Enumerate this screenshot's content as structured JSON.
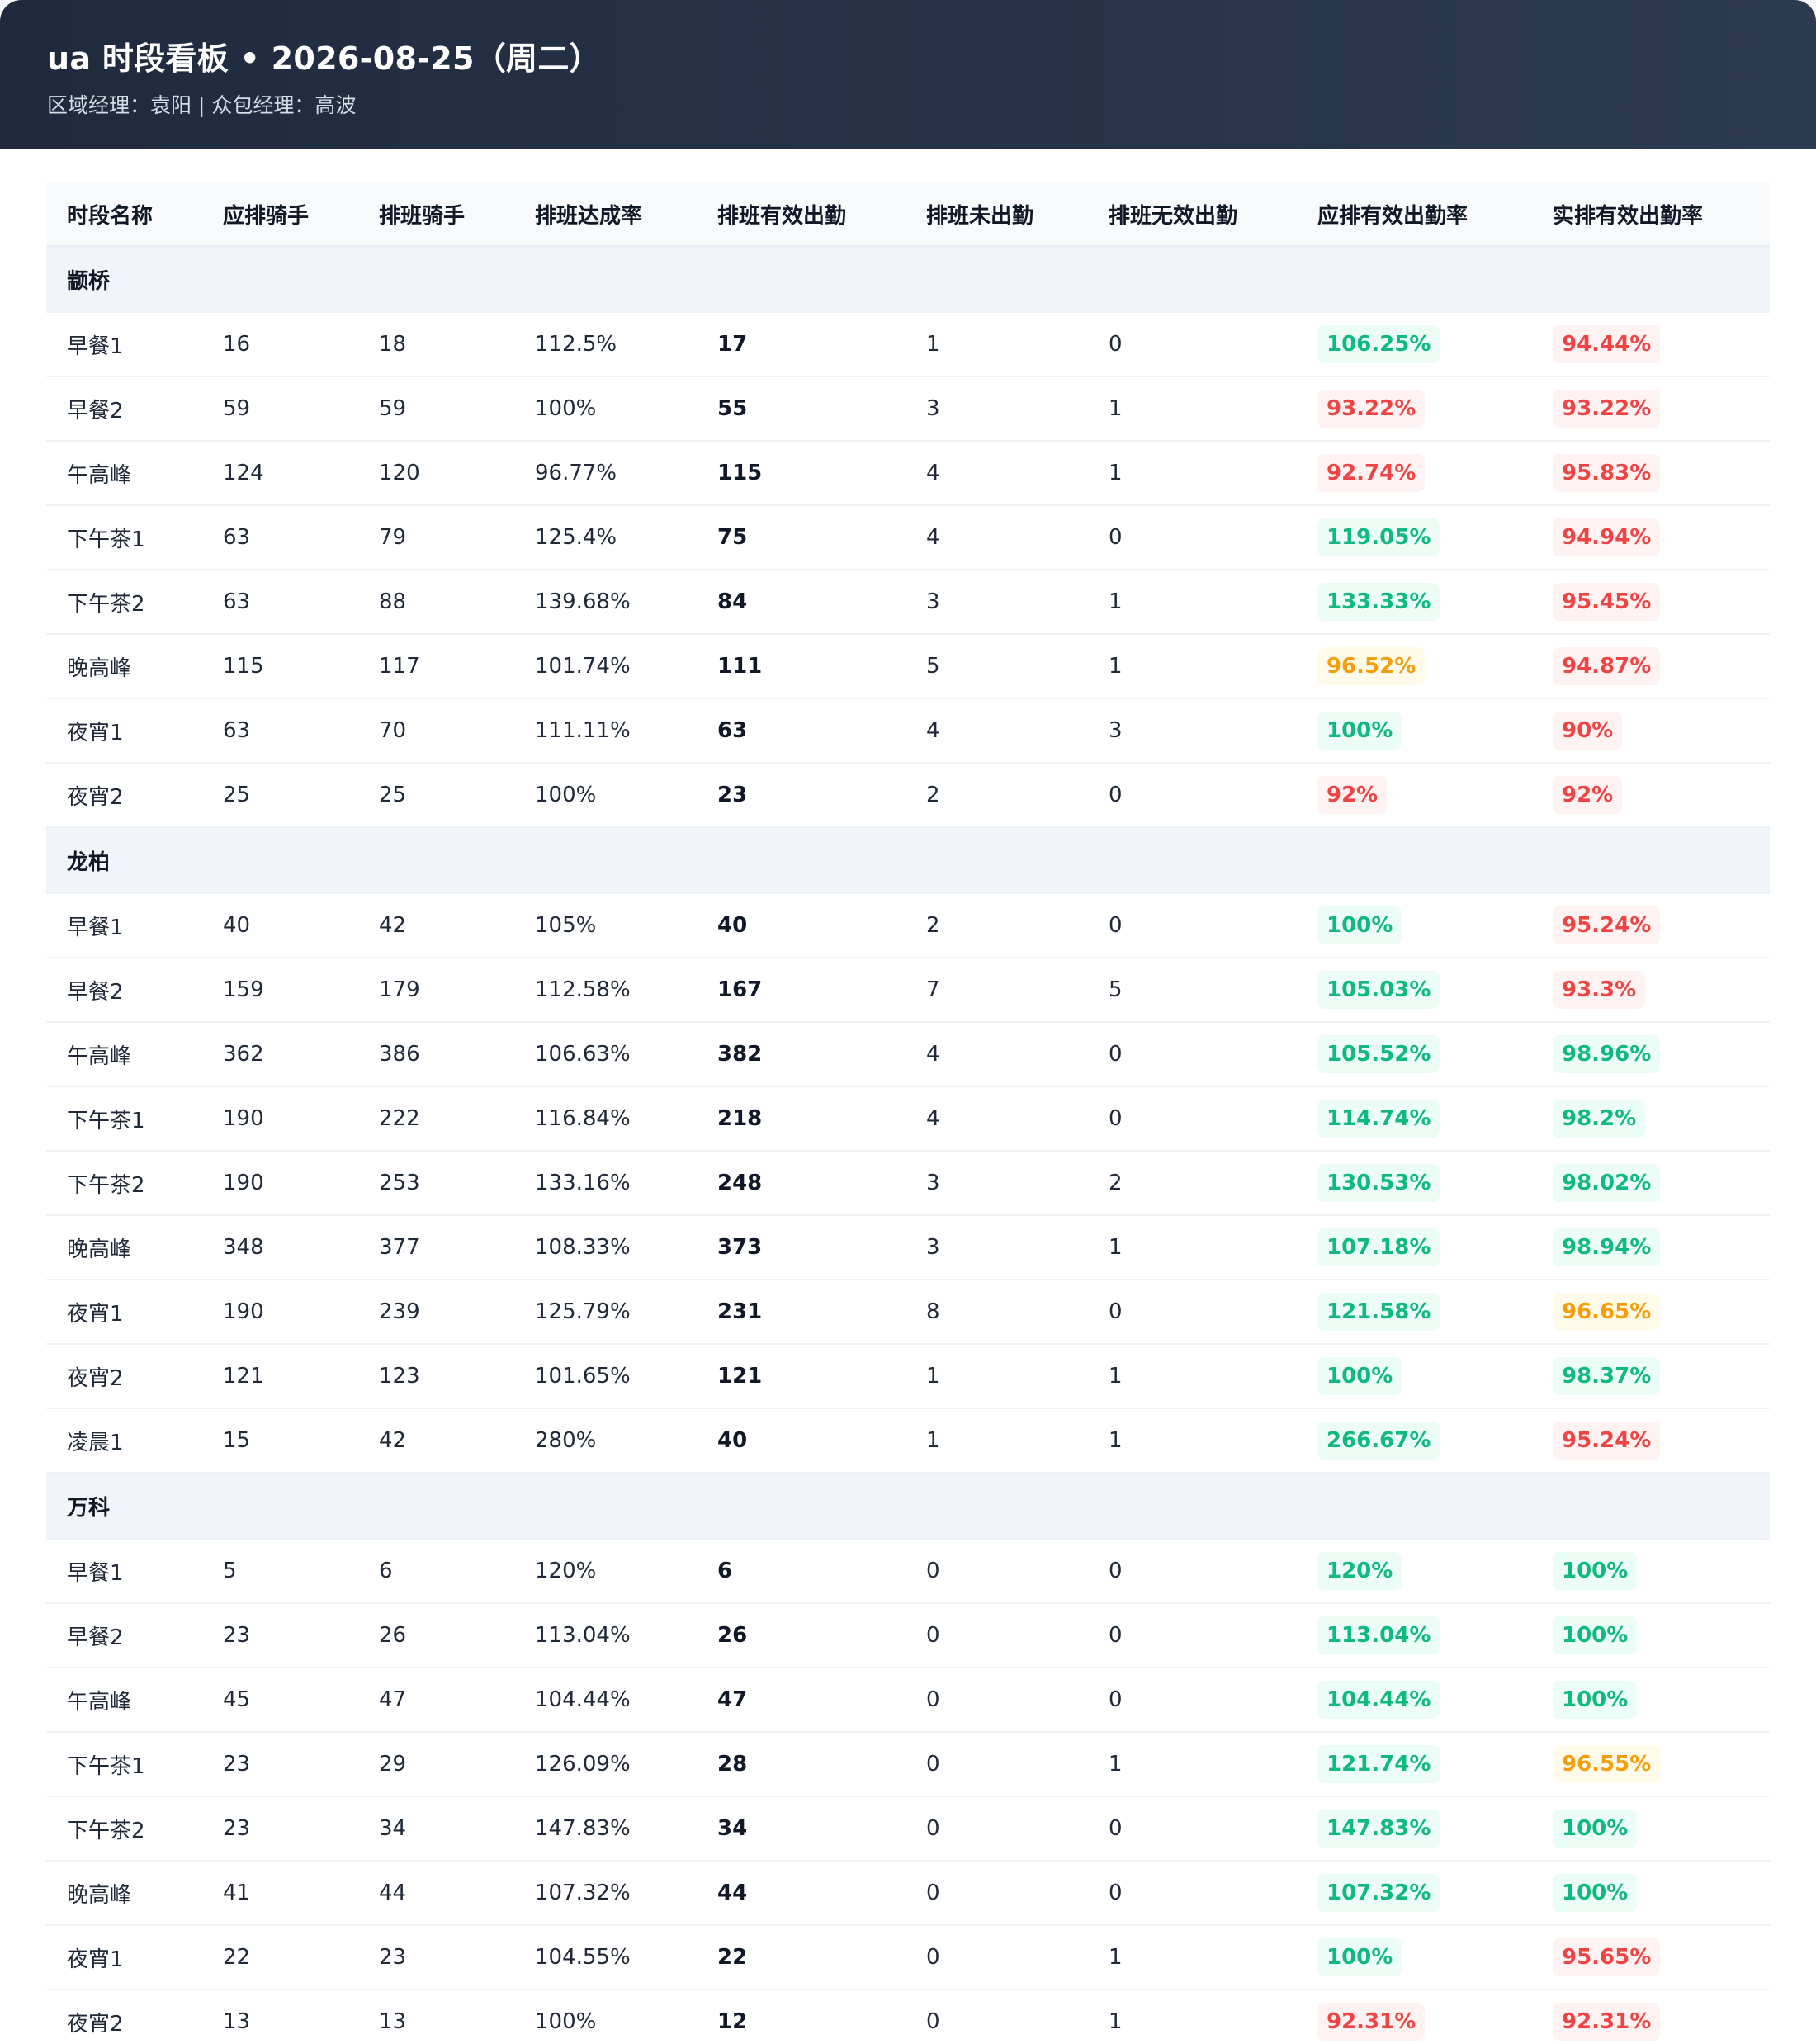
{
  "header": {
    "title": "ua 时段看板 • 2026-08-25（周二）",
    "subtitle": "区域经理：袁阳 | 众包经理：高波"
  },
  "table": {
    "columns": [
      "时段名称",
      "应排骑手",
      "排班骑手",
      "排班达成率",
      "排班有效出勤",
      "排班未出勤",
      "排班无效出勤",
      "应排有效出勤率",
      "实排有效出勤率"
    ],
    "groups": [
      {
        "name": "颛桥",
        "rows": [
          [
            "早餐1",
            "16",
            "18",
            "112.5%",
            "17",
            "1",
            "0",
            "106.25%",
            "94.44%"
          ],
          [
            "早餐2",
            "59",
            "59",
            "100%",
            "55",
            "3",
            "1",
            "93.22%",
            "93.22%"
          ],
          [
            "午高峰",
            "124",
            "120",
            "96.77%",
            "115",
            "4",
            "1",
            "92.74%",
            "95.83%"
          ],
          [
            "下午茶1",
            "63",
            "79",
            "125.4%",
            "75",
            "4",
            "0",
            "119.05%",
            "94.94%"
          ],
          [
            "下午茶2",
            "63",
            "88",
            "139.68%",
            "84",
            "3",
            "1",
            "133.33%",
            "95.45%"
          ],
          [
            "晚高峰",
            "115",
            "117",
            "101.74%",
            "111",
            "5",
            "1",
            "96.52%",
            "94.87%"
          ],
          [
            "夜宵1",
            "63",
            "70",
            "111.11%",
            "63",
            "4",
            "3",
            "100%",
            "90%"
          ],
          [
            "夜宵2",
            "25",
            "25",
            "100%",
            "23",
            "2",
            "0",
            "92%",
            "92%"
          ]
        ],
        "status": [
          [
            "good",
            "bad"
          ],
          [
            "bad",
            "bad"
          ],
          [
            "bad",
            "bad"
          ],
          [
            "good",
            "bad"
          ],
          [
            "good",
            "bad"
          ],
          [
            "warn",
            "bad"
          ],
          [
            "good",
            "bad"
          ],
          [
            "bad",
            "bad"
          ]
        ]
      },
      {
        "name": "龙柏",
        "rows": [
          [
            "早餐1",
            "40",
            "42",
            "105%",
            "40",
            "2",
            "0",
            "100%",
            "95.24%"
          ],
          [
            "早餐2",
            "159",
            "179",
            "112.58%",
            "167",
            "7",
            "5",
            "105.03%",
            "93.3%"
          ],
          [
            "午高峰",
            "362",
            "386",
            "106.63%",
            "382",
            "4",
            "0",
            "105.52%",
            "98.96%"
          ],
          [
            "下午茶1",
            "190",
            "222",
            "116.84%",
            "218",
            "4",
            "0",
            "114.74%",
            "98.2%"
          ],
          [
            "下午茶2",
            "190",
            "253",
            "133.16%",
            "248",
            "3",
            "2",
            "130.53%",
            "98.02%"
          ],
          [
            "晚高峰",
            "348",
            "377",
            "108.33%",
            "373",
            "3",
            "1",
            "107.18%",
            "98.94%"
          ],
          [
            "夜宵1",
            "190",
            "239",
            "125.79%",
            "231",
            "8",
            "0",
            "121.58%",
            "96.65%"
          ],
          [
            "夜宵2",
            "121",
            "123",
            "101.65%",
            "121",
            "1",
            "1",
            "100%",
            "98.37%"
          ],
          [
            "凌晨1",
            "15",
            "42",
            "280%",
            "40",
            "1",
            "1",
            "266.67%",
            "95.24%"
          ]
        ],
        "status": [
          [
            "good",
            "bad"
          ],
          [
            "good",
            "bad"
          ],
          [
            "good",
            "good"
          ],
          [
            "good",
            "good"
          ],
          [
            "good",
            "good"
          ],
          [
            "good",
            "good"
          ],
          [
            "good",
            "warn"
          ],
          [
            "good",
            "good"
          ],
          [
            "good",
            "bad"
          ]
        ]
      },
      {
        "name": "万科",
        "rows": [
          [
            "早餐1",
            "5",
            "6",
            "120%",
            "6",
            "0",
            "0",
            "120%",
            "100%"
          ],
          [
            "早餐2",
            "23",
            "26",
            "113.04%",
            "26",
            "0",
            "0",
            "113.04%",
            "100%"
          ],
          [
            "午高峰",
            "45",
            "47",
            "104.44%",
            "47",
            "0",
            "0",
            "104.44%",
            "100%"
          ],
          [
            "下午茶1",
            "23",
            "29",
            "126.09%",
            "28",
            "0",
            "1",
            "121.74%",
            "96.55%"
          ],
          [
            "下午茶2",
            "23",
            "34",
            "147.83%",
            "34",
            "0",
            "0",
            "147.83%",
            "100%"
          ],
          [
            "晚高峰",
            "41",
            "44",
            "107.32%",
            "44",
            "0",
            "0",
            "107.32%",
            "100%"
          ],
          [
            "夜宵1",
            "22",
            "23",
            "104.55%",
            "22",
            "0",
            "1",
            "100%",
            "95.65%"
          ],
          [
            "夜宵2",
            "13",
            "13",
            "100%",
            "12",
            "0",
            "1",
            "92.31%",
            "92.31%"
          ]
        ],
        "status": [
          [
            "good",
            "good"
          ],
          [
            "good",
            "good"
          ],
          [
            "good",
            "good"
          ],
          [
            "good",
            "warn"
          ],
          [
            "good",
            "good"
          ],
          [
            "good",
            "good"
          ],
          [
            "good",
            "bad"
          ],
          [
            "bad",
            "bad"
          ]
        ]
      }
    ]
  },
  "colors": {
    "good": "#10b981",
    "bad": "#ef4444",
    "warn": "#f59e0b",
    "header_bg": "#1f2a3d"
  }
}
